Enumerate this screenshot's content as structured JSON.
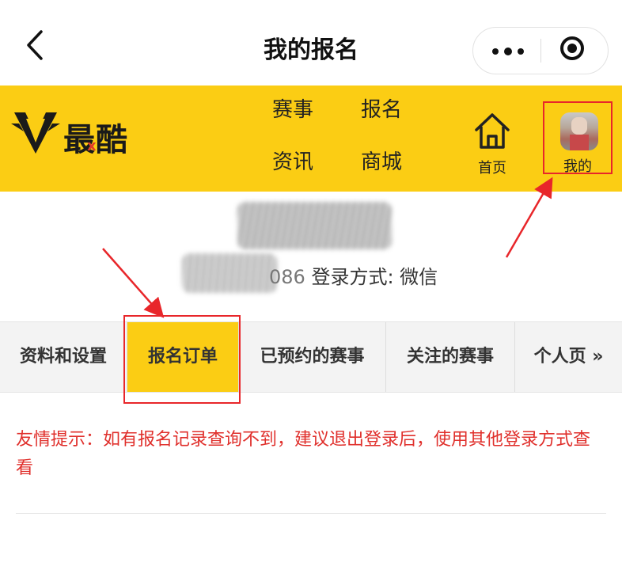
{
  "topbar": {
    "title": "我的报名",
    "back_icon": "chevron-left-icon",
    "more_icon": "more-dots-icon",
    "close_icon": "target-icon"
  },
  "header": {
    "logo_text": "最酷",
    "logo_accent": "x",
    "nav": [
      {
        "label": "赛事"
      },
      {
        "label": "报名"
      },
      {
        "label": "资讯"
      },
      {
        "label": "商城"
      }
    ],
    "home_label": "首页",
    "mine_label": "我的",
    "brand_color": "#fbcd14",
    "highlight_color": "#e8262a"
  },
  "profile": {
    "number_suffix": "086",
    "login_method": "登录方式: 微信"
  },
  "tabs": [
    {
      "label": "资料和设置"
    },
    {
      "label": "报名订单"
    },
    {
      "label": "已预约的赛事"
    },
    {
      "label": "关注的赛事"
    },
    {
      "label": "个人页 »"
    }
  ],
  "notice": {
    "text": "友情提示：如有报名记录查询不到，建议退出登录后，使用其他登录方式查看"
  }
}
